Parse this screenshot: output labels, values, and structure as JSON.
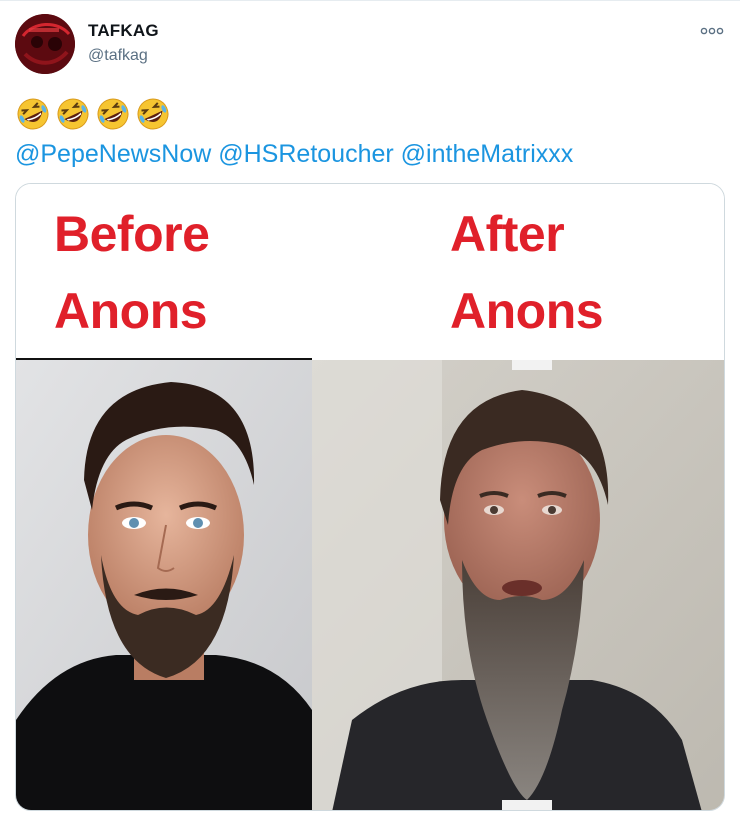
{
  "tweet": {
    "author_name": "TAFKAG",
    "author_handle": "@tafkag",
    "emoji_count": 4,
    "mentions": [
      "@PepeNewsNow",
      "@HSRetoucher",
      "@intheMatrixxx"
    ]
  },
  "media": {
    "left_caption_line1": "Before",
    "left_caption_line2": "Anons",
    "right_caption_line1": "After",
    "right_caption_line2": "Anons"
  },
  "colors": {
    "link": "#1b95e0",
    "caption": "#e0202a",
    "handle": "#5b7083"
  },
  "icons": {
    "more": "more-options-icon",
    "emoji": "rolling-on-floor-laughing-emoji"
  }
}
